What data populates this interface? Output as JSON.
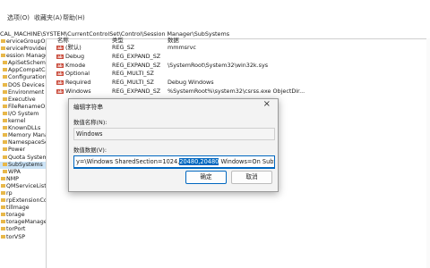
{
  "menu": [
    "选项(O)",
    "收藏夹(A)",
    "帮助(H)"
  ],
  "address": "CAL_MACHINE\\SYSTEM\\CurrentControlSet\\Control\\Session Manager\\SubSystems",
  "tree": [
    "erviceGroupOrde",
    "erviceProvider",
    "ession Manager",
    "ApiSetSchemaE",
    "AppCompatCac",
    "Configuration M",
    "DOS Devices",
    "Environment",
    "Executive",
    "FileRenameOpe",
    "I/O System",
    "kernel",
    "KnownDLLs",
    "Memory Manag",
    "NamespaceSep",
    "Power",
    "Quota System",
    "SubSystems",
    "WPA",
    "NMP",
    "QMServiceList",
    "rp",
    "rpExtensionConf",
    "tillmage",
    "torage",
    "torageManagem",
    "torPort",
    "torVSP"
  ],
  "values": {
    "headers": [
      "名称",
      "类型",
      "数据"
    ],
    "rows": [
      {
        "name": "(默认)",
        "type": "REG_SZ",
        "data": "mmmsrvc"
      },
      {
        "name": "Debug",
        "type": "REG_EXPAND_SZ",
        "data": ""
      },
      {
        "name": "Kmode",
        "type": "REG_EXPAND_SZ",
        "data": "\\SystemRoot\\System32\\win32k.sys"
      },
      {
        "name": "Optional",
        "type": "REG_MULTI_SZ",
        "data": ""
      },
      {
        "name": "Required",
        "type": "REG_MULTI_SZ",
        "data": "Debug Windows"
      },
      {
        "name": "Windows",
        "type": "REG_EXPAND_SZ",
        "data": "%SystemRoot%\\system32\\csrss.exe ObjectDir..."
      }
    ]
  },
  "dialog": {
    "title": "编辑字符串",
    "name_label": "数值名称(N):",
    "name_value": "Windows",
    "data_label": "数值数据(V):",
    "data_before": "y=\\Windows SharedSection=1024,",
    "data_selected": "20480,20480",
    "data_after": " Windows=On SubSysten",
    "ok": "确定",
    "cancel": "取消"
  },
  "colors": {
    "accent": "#0067c0",
    "selection_bg": "#cce4f7"
  }
}
